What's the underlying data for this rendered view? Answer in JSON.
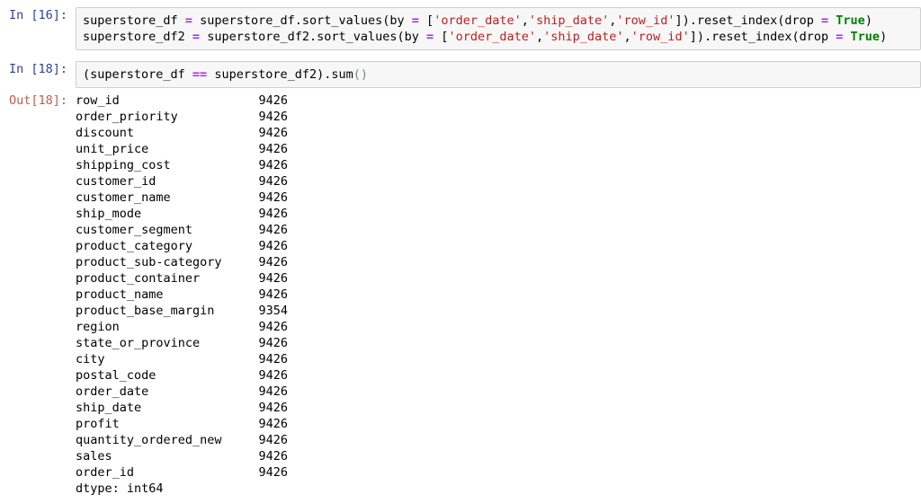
{
  "notebook": {
    "cells": [
      {
        "type": "code",
        "prompt": "In [16]:",
        "lines": [
          [
            {
              "t": "superstore_df ",
              "c": "name"
            },
            {
              "t": "=",
              "c": "op"
            },
            {
              "t": " superstore_df.sort_values(by ",
              "c": "name"
            },
            {
              "t": "=",
              "c": "op"
            },
            {
              "t": " [",
              "c": "punct"
            },
            {
              "t": "'order_date'",
              "c": "str"
            },
            {
              "t": ",",
              "c": "punct"
            },
            {
              "t": "'ship_date'",
              "c": "str"
            },
            {
              "t": ",",
              "c": "punct"
            },
            {
              "t": "'row_id'",
              "c": "str"
            },
            {
              "t": "]).reset_index(drop ",
              "c": "name"
            },
            {
              "t": "=",
              "c": "op"
            },
            {
              "t": " ",
              "c": "name"
            },
            {
              "t": "True",
              "c": "kw"
            },
            {
              "t": ")",
              "c": "punct"
            }
          ],
          [
            {
              "t": "superstore_df2 ",
              "c": "name"
            },
            {
              "t": "=",
              "c": "op"
            },
            {
              "t": " superstore_df2.sort_values(by ",
              "c": "name"
            },
            {
              "t": "=",
              "c": "op"
            },
            {
              "t": " [",
              "c": "punct"
            },
            {
              "t": "'order_date'",
              "c": "str"
            },
            {
              "t": ",",
              "c": "punct"
            },
            {
              "t": "'ship_date'",
              "c": "str"
            },
            {
              "t": ",",
              "c": "punct"
            },
            {
              "t": "'row_id'",
              "c": "str"
            },
            {
              "t": "]).reset_index(drop ",
              "c": "name"
            },
            {
              "t": "=",
              "c": "op"
            },
            {
              "t": " ",
              "c": "name"
            },
            {
              "t": "True",
              "c": "kw"
            },
            {
              "t": ")",
              "c": "punct"
            }
          ]
        ]
      },
      {
        "type": "code",
        "prompt": "In [18]:",
        "lines": [
          [
            {
              "t": "(superstore_df ",
              "c": "name"
            },
            {
              "t": "==",
              "c": "op"
            },
            {
              "t": " superstore_df2).sum",
              "c": "name"
            },
            {
              "t": "()",
              "c": "paren"
            }
          ]
        ]
      }
    ],
    "output": {
      "prompt": "Out[18]:",
      "rows": [
        {
          "key": "row_id",
          "value": "9426"
        },
        {
          "key": "order_priority",
          "value": "9426"
        },
        {
          "key": "discount",
          "value": "9426"
        },
        {
          "key": "unit_price",
          "value": "9426"
        },
        {
          "key": "shipping_cost",
          "value": "9426"
        },
        {
          "key": "customer_id",
          "value": "9426"
        },
        {
          "key": "customer_name",
          "value": "9426"
        },
        {
          "key": "ship_mode",
          "value": "9426"
        },
        {
          "key": "customer_segment",
          "value": "9426"
        },
        {
          "key": "product_category",
          "value": "9426"
        },
        {
          "key": "product_sub-category",
          "value": "9426"
        },
        {
          "key": "product_container",
          "value": "9426"
        },
        {
          "key": "product_name",
          "value": "9426"
        },
        {
          "key": "product_base_margin",
          "value": "9354"
        },
        {
          "key": "region",
          "value": "9426"
        },
        {
          "key": "state_or_province",
          "value": "9426"
        },
        {
          "key": "city",
          "value": "9426"
        },
        {
          "key": "postal_code",
          "value": "9426"
        },
        {
          "key": "order_date",
          "value": "9426"
        },
        {
          "key": "ship_date",
          "value": "9426"
        },
        {
          "key": "profit",
          "value": "9426"
        },
        {
          "key": "quantity_ordered_new",
          "value": "9426"
        },
        {
          "key": "sales",
          "value": "9426"
        },
        {
          "key": "order_id",
          "value": "9426"
        }
      ],
      "dtype_line": "dtype: int64"
    }
  },
  "colors": {
    "prompt_in": "#303f9f",
    "prompt_out": "#c25b52",
    "string": "#ba2121",
    "operator": "#aa22ff",
    "keyword": "#008000",
    "cell_background": "#f7f7f7",
    "cell_border": "#cfcfcf",
    "page_background": "#ffffff"
  }
}
